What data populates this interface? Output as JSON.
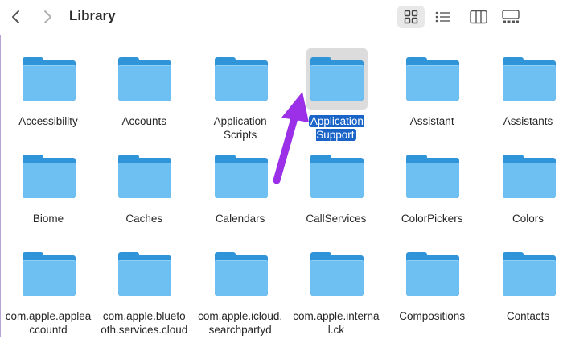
{
  "window": {
    "title": "Library"
  },
  "toolbar": {
    "back_icon": "chevron-left-icon",
    "forward_icon": "chevron-right-icon",
    "views": [
      {
        "name": "icon-view",
        "active": true
      },
      {
        "name": "list-view",
        "active": false
      },
      {
        "name": "column-view",
        "active": false
      },
      {
        "name": "gallery-view",
        "active": false
      }
    ]
  },
  "colors": {
    "folder_front": "#6ec0f3",
    "folder_back": "#2f95d8",
    "selection_bg": "#1a64c8",
    "annotation_arrow": "#9b30e8"
  },
  "folders": [
    {
      "label": "Accessibility",
      "selected": false
    },
    {
      "label": "Accounts",
      "selected": false
    },
    {
      "label": "Application\nScripts",
      "selected": false
    },
    {
      "label": "Application\nSupport",
      "selected": true
    },
    {
      "label": "Assistant",
      "selected": false
    },
    {
      "label": "Assistants",
      "selected": false
    },
    {
      "label": "Biome",
      "selected": false
    },
    {
      "label": "Caches",
      "selected": false
    },
    {
      "label": "Calendars",
      "selected": false
    },
    {
      "label": "CallServices",
      "selected": false
    },
    {
      "label": "ColorPickers",
      "selected": false
    },
    {
      "label": "Colors",
      "selected": false
    },
    {
      "label": "com.apple.applea\nccountd",
      "selected": false
    },
    {
      "label": "com.apple.blueto\noth.services.cloud",
      "selected": false
    },
    {
      "label": "com.apple.icloud.\nsearchpartyd",
      "selected": false
    },
    {
      "label": "com.apple.interna\nl.ck",
      "selected": false
    },
    {
      "label": "Compositions",
      "selected": false
    },
    {
      "label": "Contacts",
      "selected": false
    }
  ]
}
